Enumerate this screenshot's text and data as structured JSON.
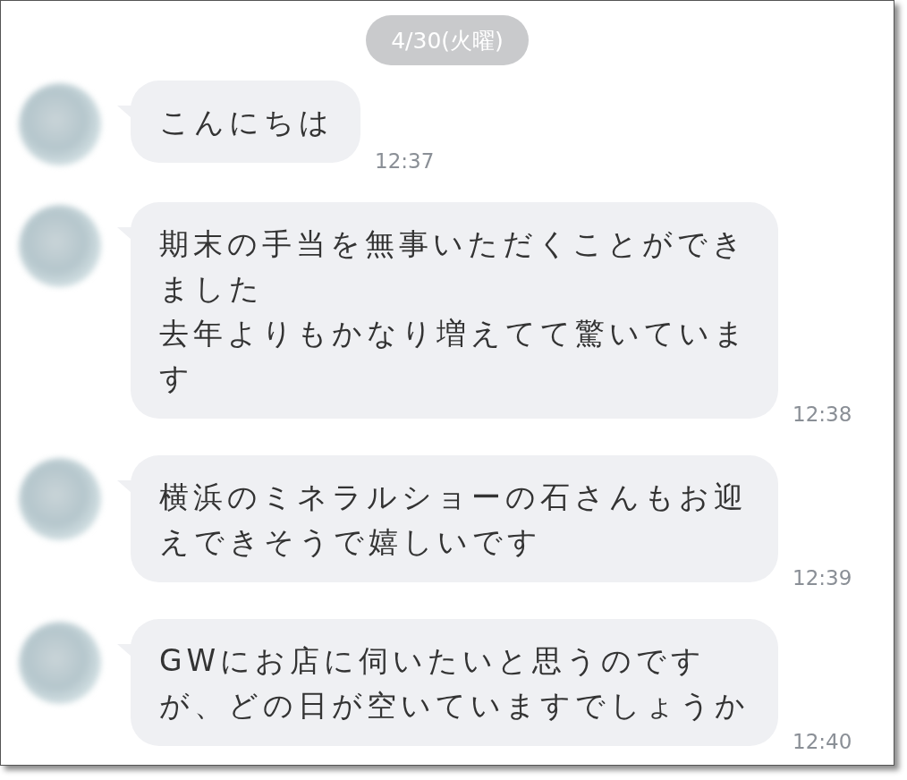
{
  "date_separator": "4/30(火曜)",
  "messages": [
    {
      "paragraphs": [
        "こんにちは"
      ],
      "time": "12:37"
    },
    {
      "paragraphs": [
        "期末の手当を無事いただくことができました",
        "去年よりもかなり増えてて驚いています"
      ],
      "time": "12:38"
    },
    {
      "paragraphs": [
        "横浜のミネラルショーの石さんもお迎えできそうで嬉しいです"
      ],
      "time": "12:39"
    },
    {
      "paragraphs": [
        "GWにお店に伺いたいと思うのですが、どの日が空いていますでしょうか"
      ],
      "time": "12:40"
    }
  ]
}
